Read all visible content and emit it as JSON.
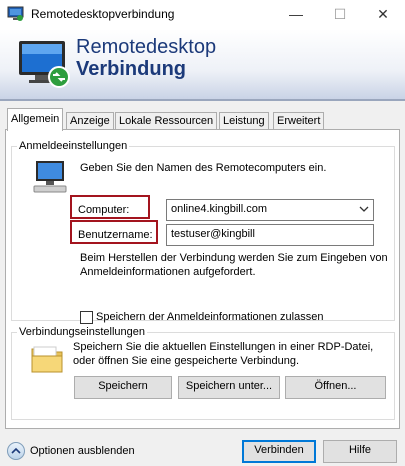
{
  "window": {
    "title": "Remotedesktopverbindung",
    "minimize": "—",
    "maximize": "☐",
    "close": "✕"
  },
  "banner": {
    "line1": "Remotedesktop",
    "line2": "Verbindung"
  },
  "tabs": [
    "Allgemein",
    "Anzeige",
    "Lokale Ressourcen",
    "Leistung",
    "Erweitert"
  ],
  "logon": {
    "group_title": "Anmeldeeinstellungen",
    "instruction": "Geben Sie den Namen des Remotecomputers ein.",
    "computer_label": "Computer:",
    "computer_value": "online4.kingbill.com",
    "user_label": "Benutzername:",
    "user_value": "testuser@kingbill",
    "note_line1": "Beim Herstellen der Verbindung werden Sie zum Eingeben von",
    "note_line2": "Anmeldeinformationen aufgefordert.",
    "save_credentials_label": "Speichern der Anmeldeinformationen zulassen",
    "save_credentials_checked": false
  },
  "connection": {
    "group_title": "Verbindungseinstellungen",
    "desc_line1": "Speichern Sie die aktuellen Einstellungen in einer RDP-Datei,",
    "desc_line2": "oder öffnen Sie eine gespeicherte Verbindung.",
    "save_button": "Speichern",
    "save_as_button": "Speichern unter...",
    "open_button": "Öffnen..."
  },
  "footer": {
    "options_label": "Optionen ausblenden",
    "connect_button": "Verbinden",
    "help_button": "Hilfe"
  },
  "colors": {
    "highlight": "#a3141e",
    "title_blue": "#1c3a7a",
    "default_button_border": "#0078d7"
  }
}
